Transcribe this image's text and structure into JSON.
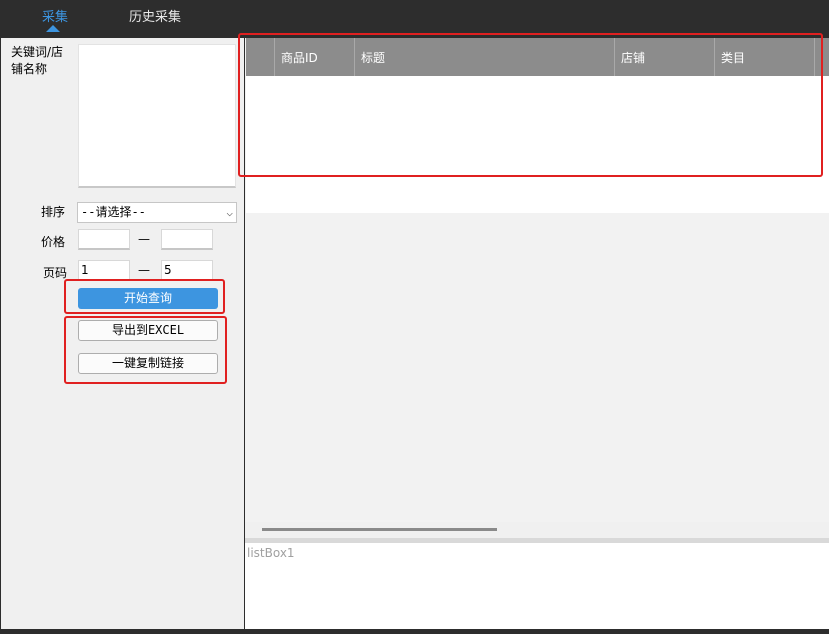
{
  "tabs": [
    {
      "label": "采集",
      "active": true
    },
    {
      "label": "历史采集",
      "active": false
    }
  ],
  "form": {
    "keyword_label": "关键词/店铺名称",
    "keyword_value": "",
    "sort_label": "排序",
    "sort_selected": "--请选择--",
    "price_label": "价格",
    "price_min": "",
    "price_max": "",
    "price_sep": "—",
    "page_label": "页码",
    "page_from": "1",
    "page_to": "5",
    "page_sep": "—"
  },
  "buttons": {
    "query": "开始查询",
    "export": "导出到EXCEL",
    "copy_links": "一键复制链接"
  },
  "grid": {
    "columns": [
      "商品ID",
      "标题",
      "店铺",
      "类目"
    ],
    "rows": []
  },
  "listbox": {
    "label": "listBox1"
  },
  "colors": {
    "accent": "#3d95e0",
    "annotation": "#e02020",
    "header_bg": "#8c8c8c",
    "dark_bg": "#2d2d2d"
  }
}
